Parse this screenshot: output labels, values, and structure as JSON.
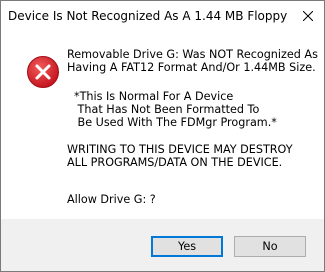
{
  "window": {
    "title": "Device Is Not Recognized As A 1.44 MB Floppy"
  },
  "icons": {
    "close": "close-icon",
    "error": "error-icon"
  },
  "message": {
    "paragraph1": "Removable Drive G: Was NOT Recognized As\nHaving A FAT12 Format And/Or 1.44MB Size.",
    "paragraph2": "*This Is Normal For A Device\n That Has Not Been Formatted To\n Be Used With The FDMgr Program.*",
    "paragraph3": "WRITING TO THIS DEVICE MAY DESTROY\nALL PROGRAMS/DATA ON THE DEVICE.",
    "paragraph4": "Allow Drive G: ?"
  },
  "buttons": {
    "yes": "Yes",
    "no": "No"
  },
  "colors": {
    "error_red": "#e81123",
    "focus_border": "#0078d7",
    "footer_bg": "#f0f0f0"
  }
}
